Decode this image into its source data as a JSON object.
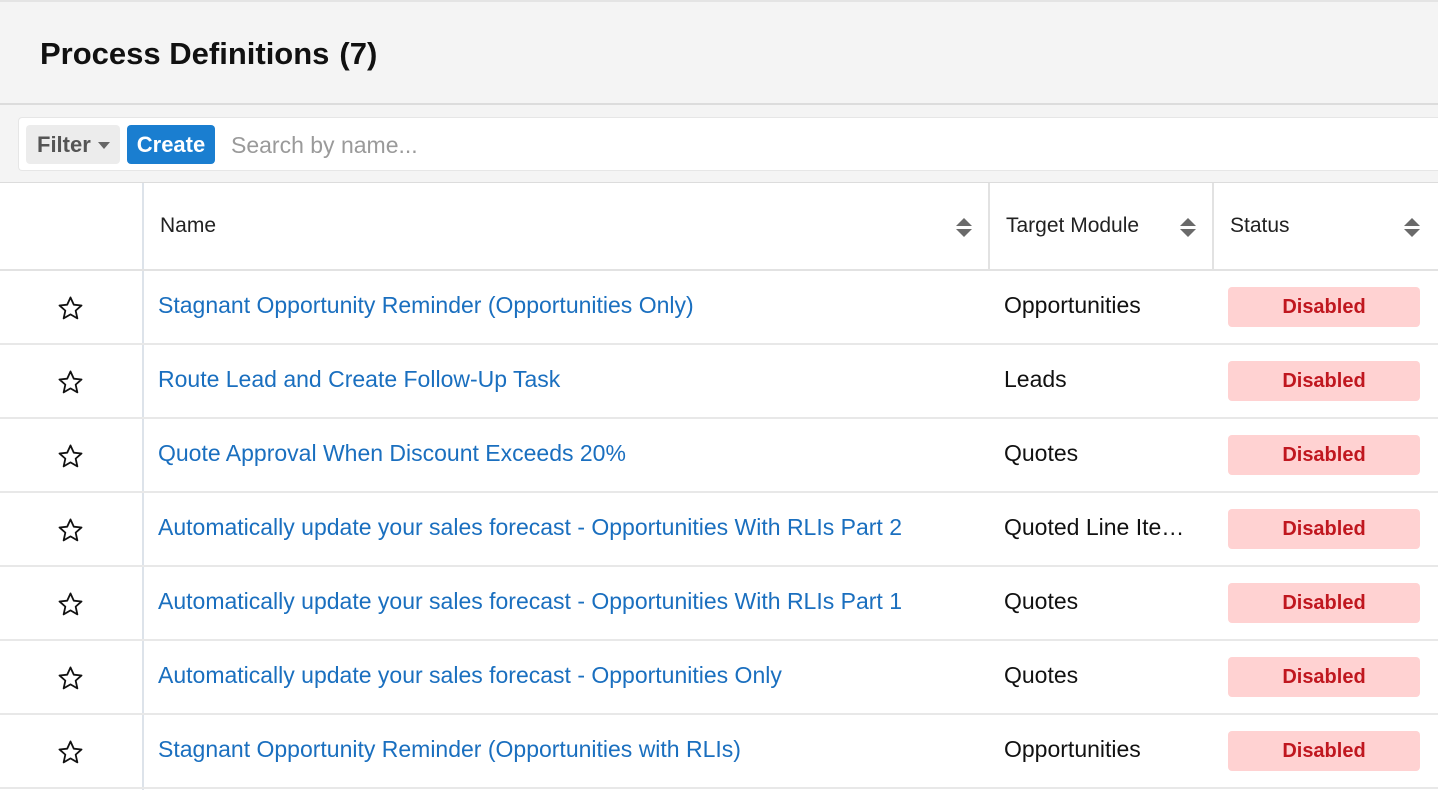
{
  "header": {
    "title": "Process Definitions",
    "count": "(7)"
  },
  "toolbar": {
    "filter_label": "Filter",
    "create_label": "Create",
    "search_placeholder": "Search by name...",
    "search_value": ""
  },
  "columns": {
    "name": "Name",
    "target_module": "Target Module",
    "status": "Status"
  },
  "rows": [
    {
      "name": "Stagnant Opportunity Reminder (Opportunities Only)",
      "module": "Opportunities",
      "status": "Disabled"
    },
    {
      "name": "Route Lead and Create Follow-Up Task",
      "module": "Leads",
      "status": "Disabled"
    },
    {
      "name": "Quote Approval When Discount Exceeds 20%",
      "module": "Quotes",
      "status": "Disabled"
    },
    {
      "name": "Automatically update your sales forecast - Opportunities With RLIs Part 2",
      "module": "Quoted Line Ite…",
      "status": "Disabled"
    },
    {
      "name": "Automatically update your sales forecast - Opportunities With RLIs Part 1",
      "module": "Quotes",
      "status": "Disabled"
    },
    {
      "name": "Automatically update your sales forecast - Opportunities Only",
      "module": "Quotes",
      "status": "Disabled"
    },
    {
      "name": "Stagnant Opportunity Reminder (Opportunities with RLIs)",
      "module": "Opportunities",
      "status": "Disabled"
    }
  ],
  "icons": {
    "favorite": "star-outline-icon",
    "sort": "sort-icon",
    "filter_caret": "caret-down-icon"
  },
  "colors": {
    "link": "#1a6fbf",
    "primary_button": "#1a7ed0",
    "status_disabled_bg": "#ffd2d2",
    "status_disabled_text": "#c0171f"
  }
}
